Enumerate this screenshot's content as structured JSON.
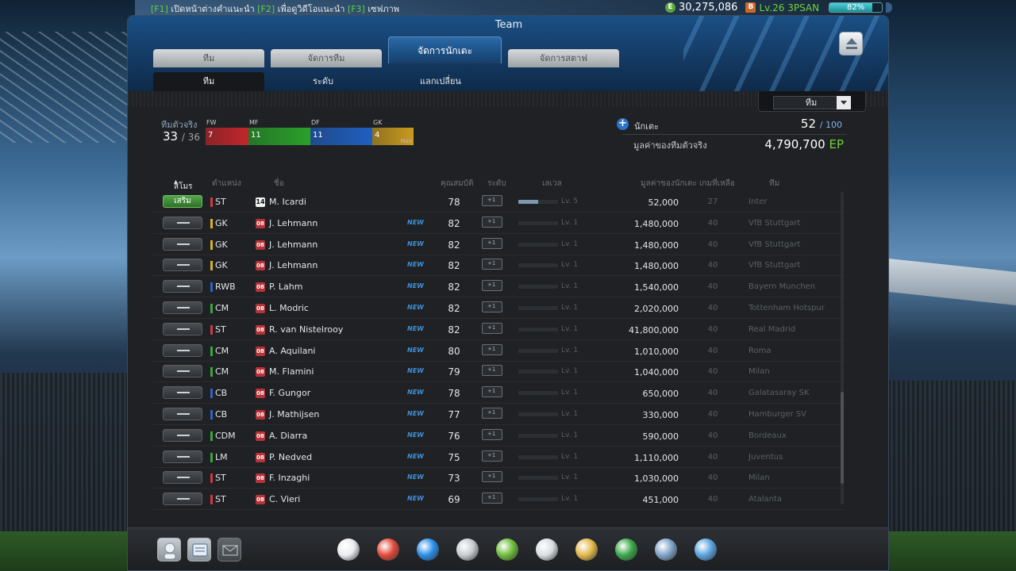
{
  "topbar": {
    "hotkeys": [
      {
        "key": "[F1]",
        "text": " เปิดหน้าต่างคำแนะนำ "
      },
      {
        "key": "[F2]",
        "text": " เพื่อดูวิดีโอแนะนำ "
      },
      {
        "key": "[F3]",
        "text": " เซฟภาพ"
      }
    ],
    "money": "30,275,086",
    "level": "Lv.26 3PSAN",
    "exp_percent": "82%",
    "exp_fraction": 0.82,
    "coin_glyph": "E",
    "level_glyph": "B"
  },
  "window": {
    "title": "Team",
    "tabs": [
      "ทีม",
      "จัดการทีม",
      "จัดการนักเตะ",
      "จัดการสตาฟ"
    ],
    "active_tab": 2,
    "subtabs": [
      "ทีม",
      "ระดับ",
      "แลกเปลี่ยน"
    ],
    "active_subtab": 0
  },
  "view_select": {
    "value": "ทีม"
  },
  "squad": {
    "label": "ทีมตัวจริง",
    "count": "33",
    "max": "/ 36",
    "positions": [
      {
        "label": "FW",
        "count": "7",
        "color": "#c0262b"
      },
      {
        "label": "MF",
        "count": "11",
        "color": "#2aa02a"
      },
      {
        "label": "DF",
        "count": "11",
        "color": "#1f5fbf"
      },
      {
        "label": "GK",
        "count": "4",
        "color": "#c99a1e"
      }
    ],
    "max_tag": "Max"
  },
  "summary": {
    "players_label": "นักเตะ",
    "players_count": "52",
    "players_max": "/ 100",
    "team_value_label": "มูลค่าของทีมตัวจริง",
    "team_value": "4,790,700",
    "team_value_unit": "EP"
  },
  "table": {
    "headers": {
      "status": "สโมร",
      "position": "ตำแหน่ง",
      "name": "ชื่อ",
      "ovr": "คุณสมบัติ",
      "upgrade": "ระดับ",
      "level": "เลเวล",
      "value": "มูลค่าของนักเตะ",
      "games": "เกมที่เหลือ",
      "team": "ทีม"
    },
    "rows": [
      {
        "status": "เสริม",
        "pos": "ST",
        "pos_color": "#d23a3f",
        "badge": "14",
        "name": "M. Icardi",
        "new": "",
        "ovr": "78",
        "level": "Lv. 5",
        "level_fill": 0.5,
        "value": "52,000",
        "games": "27",
        "team": "Inter"
      },
      {
        "status": "",
        "pos": "GK",
        "pos_color": "#d8b12a",
        "badge": "08",
        "name": "J. Lehmann",
        "new": "NEW",
        "ovr": "82",
        "level": "Lv. 1",
        "level_fill": 0,
        "value": "1,480,000",
        "games": "40",
        "team": "VfB Stuttgart"
      },
      {
        "status": "",
        "pos": "GK",
        "pos_color": "#d8b12a",
        "badge": "08",
        "name": "J. Lehmann",
        "new": "NEW",
        "ovr": "82",
        "level": "Lv. 1",
        "level_fill": 0,
        "value": "1,480,000",
        "games": "40",
        "team": "VfB Stuttgart"
      },
      {
        "status": "",
        "pos": "GK",
        "pos_color": "#d8b12a",
        "badge": "08",
        "name": "J. Lehmann",
        "new": "NEW",
        "ovr": "82",
        "level": "Lv. 1",
        "level_fill": 0,
        "value": "1,480,000",
        "games": "40",
        "team": "VfB Stuttgart"
      },
      {
        "status": "",
        "pos": "RWB",
        "pos_color": "#2f63c9",
        "badge": "08",
        "name": "P. Lahm",
        "new": "NEW",
        "ovr": "82",
        "level": "Lv. 1",
        "level_fill": 0,
        "value": "1,540,000",
        "games": "40",
        "team": "Bayern Munchen"
      },
      {
        "status": "",
        "pos": "CM",
        "pos_color": "#3aa83a",
        "badge": "08",
        "name": "L. Modric",
        "new": "NEW",
        "ovr": "82",
        "level": "Lv. 1",
        "level_fill": 0,
        "value": "2,020,000",
        "games": "40",
        "team": "Tottenham Hotspur"
      },
      {
        "status": "",
        "pos": "ST",
        "pos_color": "#d23a3f",
        "badge": "08",
        "name": "R. van Nistelrooy",
        "new": "NEW",
        "ovr": "82",
        "level": "Lv. 1",
        "level_fill": 0,
        "value": "41,800,000",
        "games": "40",
        "team": "Real Madrid"
      },
      {
        "status": "",
        "pos": "CM",
        "pos_color": "#3aa83a",
        "badge": "08",
        "name": "A. Aquilani",
        "new": "NEW",
        "ovr": "80",
        "level": "Lv. 1",
        "level_fill": 0,
        "value": "1,010,000",
        "games": "40",
        "team": "Roma"
      },
      {
        "status": "",
        "pos": "CM",
        "pos_color": "#3aa83a",
        "badge": "08",
        "name": "M. Flamini",
        "new": "NEW",
        "ovr": "79",
        "level": "Lv. 1",
        "level_fill": 0,
        "value": "1,040,000",
        "games": "40",
        "team": "Milan"
      },
      {
        "status": "",
        "pos": "CB",
        "pos_color": "#2f63c9",
        "badge": "08",
        "name": "F. Gungor",
        "new": "NEW",
        "ovr": "78",
        "level": "Lv. 1",
        "level_fill": 0,
        "value": "650,000",
        "games": "40",
        "team": "Galatasaray SK"
      },
      {
        "status": "",
        "pos": "CB",
        "pos_color": "#2f63c9",
        "badge": "08",
        "name": "J. Mathijsen",
        "new": "NEW",
        "ovr": "77",
        "level": "Lv. 1",
        "level_fill": 0,
        "value": "330,000",
        "games": "40",
        "team": "Hamburger SV"
      },
      {
        "status": "",
        "pos": "CDM",
        "pos_color": "#3aa83a",
        "badge": "08",
        "name": "A. Diarra",
        "new": "NEW",
        "ovr": "76",
        "level": "Lv. 1",
        "level_fill": 0,
        "value": "590,000",
        "games": "40",
        "team": "Bordeaux"
      },
      {
        "status": "",
        "pos": "LM",
        "pos_color": "#3aa83a",
        "badge": "08",
        "name": "P. Nedved",
        "new": "NEW",
        "ovr": "75",
        "level": "Lv. 1",
        "level_fill": 0,
        "value": "1,110,000",
        "games": "40",
        "team": "Juventus"
      },
      {
        "status": "",
        "pos": "ST",
        "pos_color": "#d23a3f",
        "badge": "08",
        "name": "F. Inzaghi",
        "new": "NEW",
        "ovr": "73",
        "level": "Lv. 1",
        "level_fill": 0,
        "value": "1,030,000",
        "games": "40",
        "team": "Milan"
      },
      {
        "status": "",
        "pos": "ST",
        "pos_color": "#d23a3f",
        "badge": "08",
        "name": "C. Vieri",
        "new": "NEW",
        "ovr": "69",
        "level": "Lv. 1",
        "level_fill": 0,
        "value": "451,000",
        "games": "40",
        "team": "Atalanta"
      }
    ]
  },
  "bottom": {
    "left_icons": [
      "profile-icon",
      "messages-icon",
      "mail-icon"
    ],
    "game_icons": [
      {
        "name": "whistle-icon",
        "color": "#e9ecef"
      },
      {
        "name": "ball-icon",
        "color": "#e24a3a"
      },
      {
        "name": "boot-icon",
        "color": "#2a8ee8"
      },
      {
        "name": "trophy-icon",
        "color": "#c7ccd1"
      },
      {
        "name": "ranking-icon",
        "color": "#6dbd3a"
      },
      {
        "name": "notepad-icon",
        "color": "#d9dee3"
      },
      {
        "name": "shirt-icon",
        "color": "#e1b84a"
      },
      {
        "name": "club-icon",
        "color": "#3aa84a"
      },
      {
        "name": "manager-icon",
        "color": "#7fa3c7"
      },
      {
        "name": "shop-cart-icon",
        "color": "#5aa4e0"
      }
    ]
  }
}
